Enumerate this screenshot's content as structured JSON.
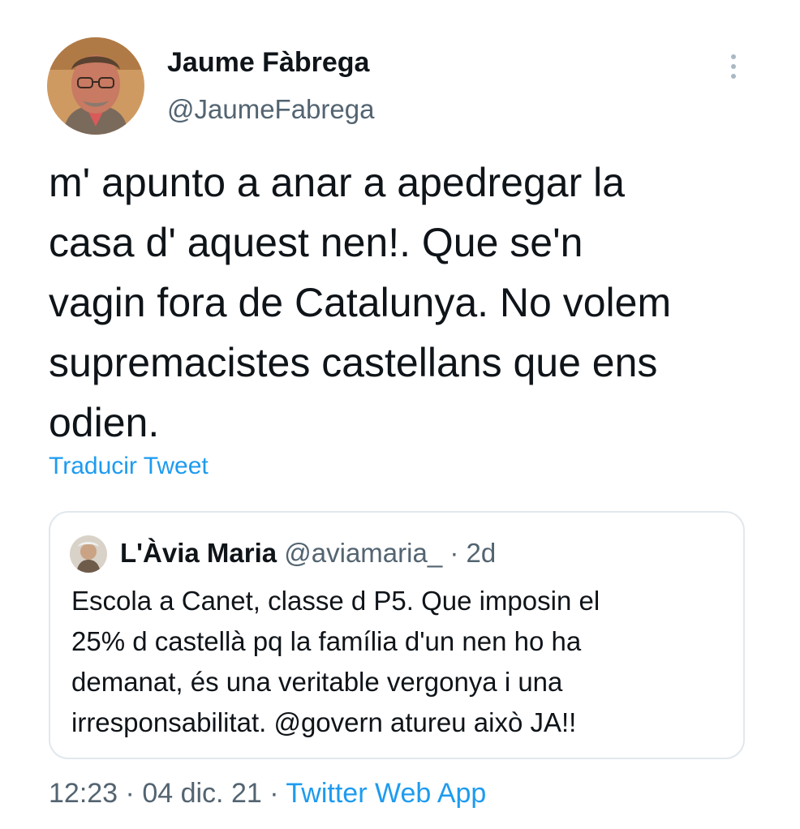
{
  "tweet": {
    "author": {
      "name": "Jaume Fàbrega",
      "handle": "@JaumeFabrega",
      "avatar_icon": "profile-photo"
    },
    "more_icon": "more-options-icon",
    "text": "m' apunto a anar a apedregar la\ncasa d' aquest nen!. Que se'n\nvagin fora de Catalunya. No volem\nsupremacistes castellans que ens\nodien.",
    "translate_label": "Traducir Tweet",
    "quoted": {
      "name": "L'Àvia Maria",
      "handle": "@aviamaria_",
      "separator": "·",
      "time": "2d",
      "text": "Escola a Canet, classe d P5. Que imposin el\n25% d castellà pq la família d'un nen ho ha\ndemanat, és una veritable vergonya i una\nirresponsabilitat. @govern atureu això JA!!"
    },
    "meta": {
      "time": "12:23",
      "date": "04 dic. 21",
      "separator": "·",
      "source": "Twitter Web App"
    }
  },
  "colors": {
    "text_primary": "#0f1419",
    "text_secondary": "#536471",
    "link": "#1d9bf0",
    "border": "#e1e8ed",
    "background": "#ffffff"
  }
}
